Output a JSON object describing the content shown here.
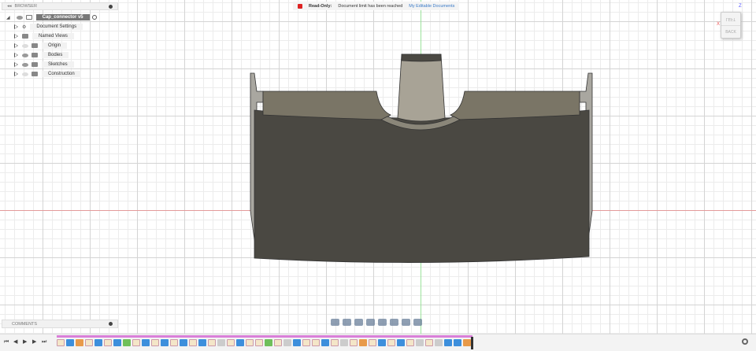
{
  "browser": {
    "title": "BROWSER",
    "root": "Cap_connector v5",
    "items": [
      {
        "label": "Document Settings",
        "icon": "gear-icon",
        "eye": "none"
      },
      {
        "label": "Named Views",
        "icon": "folder-icon",
        "eye": "none"
      },
      {
        "label": "Origin",
        "icon": "folder-icon",
        "eye": "hidden"
      },
      {
        "label": "Bodies",
        "icon": "folder-icon",
        "eye": "visible"
      },
      {
        "label": "Sketches",
        "icon": "folder-icon",
        "eye": "visible"
      },
      {
        "label": "Construction",
        "icon": "folder-icon",
        "eye": "hidden"
      }
    ]
  },
  "banner": {
    "status": "Read-Only:",
    "message": "Document limit has been reached",
    "link": "My Editable Documents",
    "status_color": "#d22222"
  },
  "viewcube": {
    "top": "LEFT",
    "front": "BACK",
    "axis_z": "Z",
    "axis_x": "X"
  },
  "comments": {
    "title": "COMMENTS"
  },
  "navbar": [
    "orbit",
    "look-at",
    "pan",
    "zoom-window",
    "zoom",
    "display-settings",
    "grid-settings",
    "viewports"
  ],
  "timeline": {
    "items": [
      "sketch",
      "extrude",
      "fillet",
      "sketch",
      "extrude",
      "sketch",
      "extrude",
      "pattern",
      "sketch",
      "extrude",
      "sketch",
      "extrude",
      "sketch",
      "extrude",
      "sketch",
      "extrude",
      "sketch",
      "other",
      "sketch",
      "extrude",
      "sketch",
      "sketch",
      "pattern",
      "sketch",
      "other",
      "extrude",
      "sketch",
      "sketch",
      "extrude",
      "sketch",
      "other",
      "sketch",
      "fillet",
      "sketch",
      "extrude",
      "sketch",
      "extrude",
      "sketch",
      "other",
      "sketch",
      "other",
      "extrude",
      "extrude",
      "fillet"
    ]
  }
}
